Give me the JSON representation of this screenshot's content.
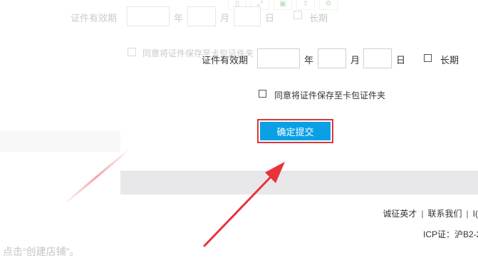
{
  "background": {
    "validity_label": "证件有效期",
    "year": "年",
    "month": "月",
    "day": "日",
    "long_term": "长期",
    "agree_label": "同意将证件保存至卡包证件夹",
    "footer_text": "点击“创建店铺”。",
    "toolbar_icons": [
      "phone-icon",
      "expand-icon",
      "save-icon",
      "share-icon",
      "settings-icon"
    ]
  },
  "form": {
    "validity_label": "证件有效期",
    "year_label": "年",
    "month_label": "月",
    "day_label": "日",
    "long_term_label": "长期",
    "agree_label": "同意将证件保存至卡包证件夹",
    "submit_label": "确定提交"
  },
  "footer": {
    "links": [
      "诚征英才",
      "联系我们",
      "I("
    ],
    "separator": "|",
    "icp": "ICP证：沪B2-2"
  },
  "colors": {
    "submit_bg": "#0aa0e6",
    "highlight_border": "#d9363e",
    "arrow": "#e8323c"
  }
}
